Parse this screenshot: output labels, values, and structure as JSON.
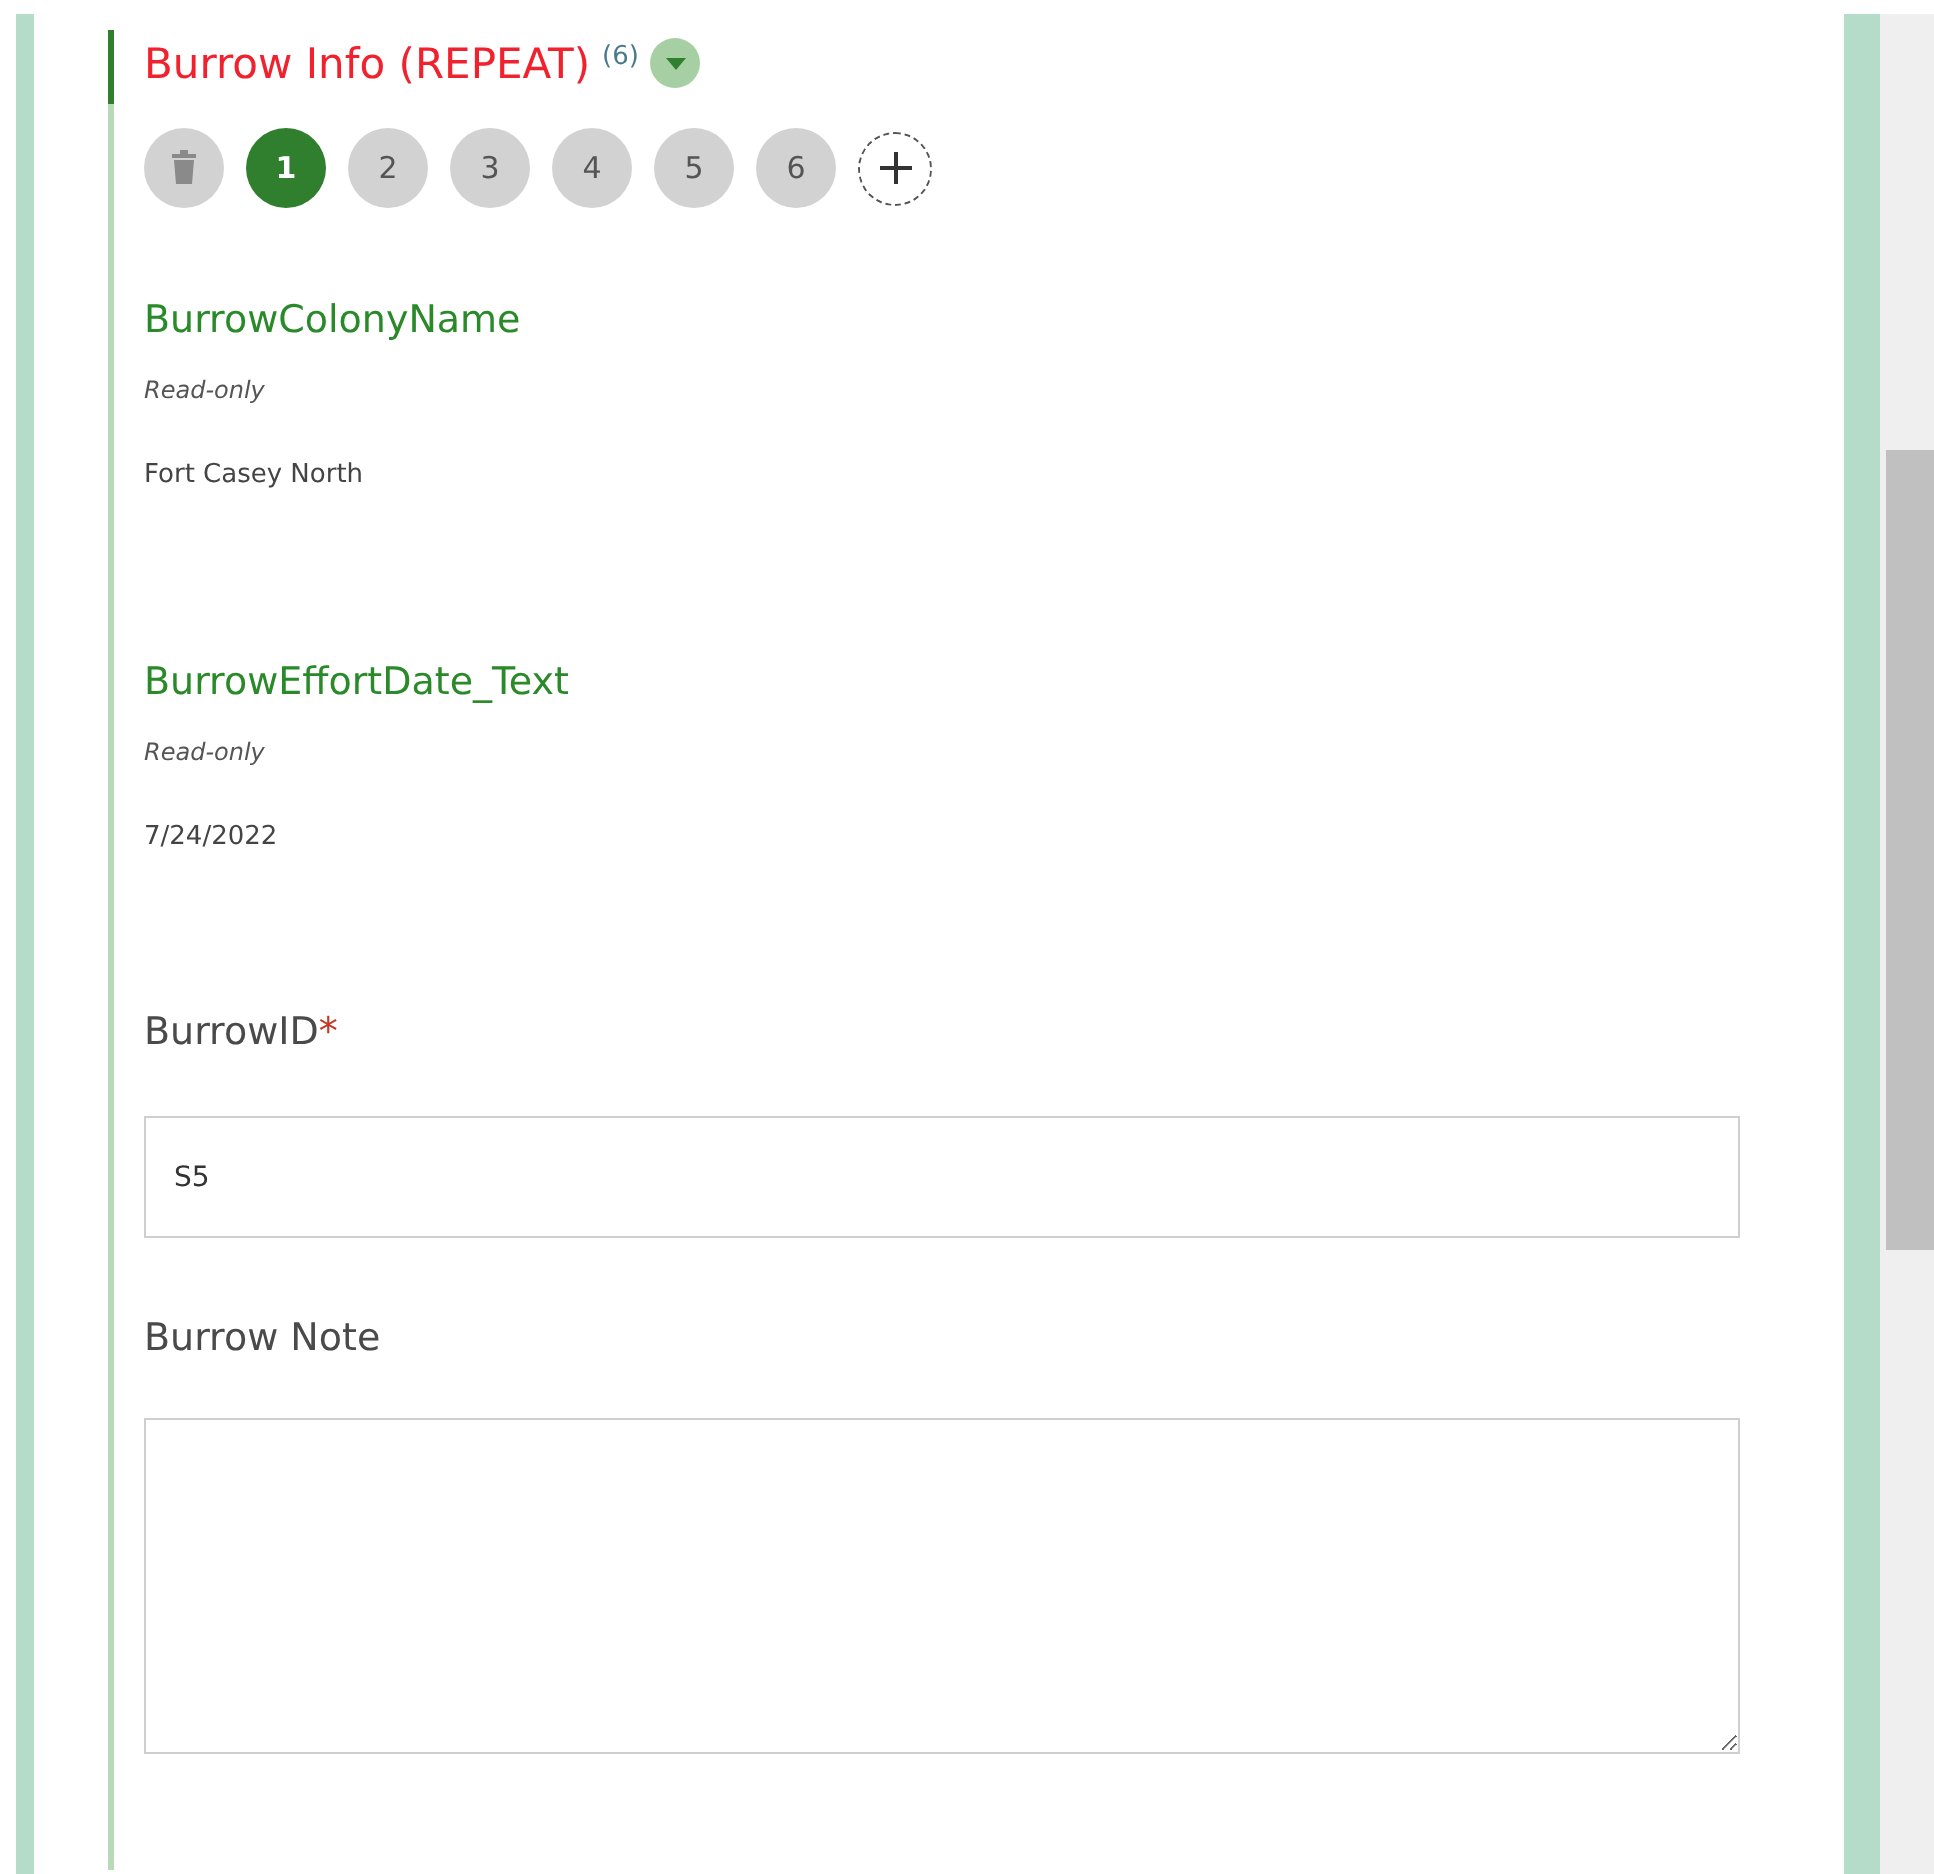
{
  "section": {
    "title": "Burrow Info (REPEAT)",
    "count": "(6)",
    "expanded": true
  },
  "records": [
    {
      "label": "1",
      "selected": true
    },
    {
      "label": "2",
      "selected": false
    },
    {
      "label": "3",
      "selected": false
    },
    {
      "label": "4",
      "selected": false
    },
    {
      "label": "5",
      "selected": false
    },
    {
      "label": "6",
      "selected": false
    }
  ],
  "fields": [
    {
      "kind": "readonly",
      "label": "BurrowColonyName",
      "note": "Read-only",
      "value": "Fort Casey North"
    },
    {
      "kind": "readonly",
      "label": "BurrowEffortDate_Text",
      "note": "Read-only",
      "value": "7/24/2022"
    },
    {
      "kind": "input",
      "label": "BurrowID",
      "required_mark": "*",
      "value": "S5"
    },
    {
      "kind": "textarea",
      "label": "Burrow Note"
    }
  ]
}
